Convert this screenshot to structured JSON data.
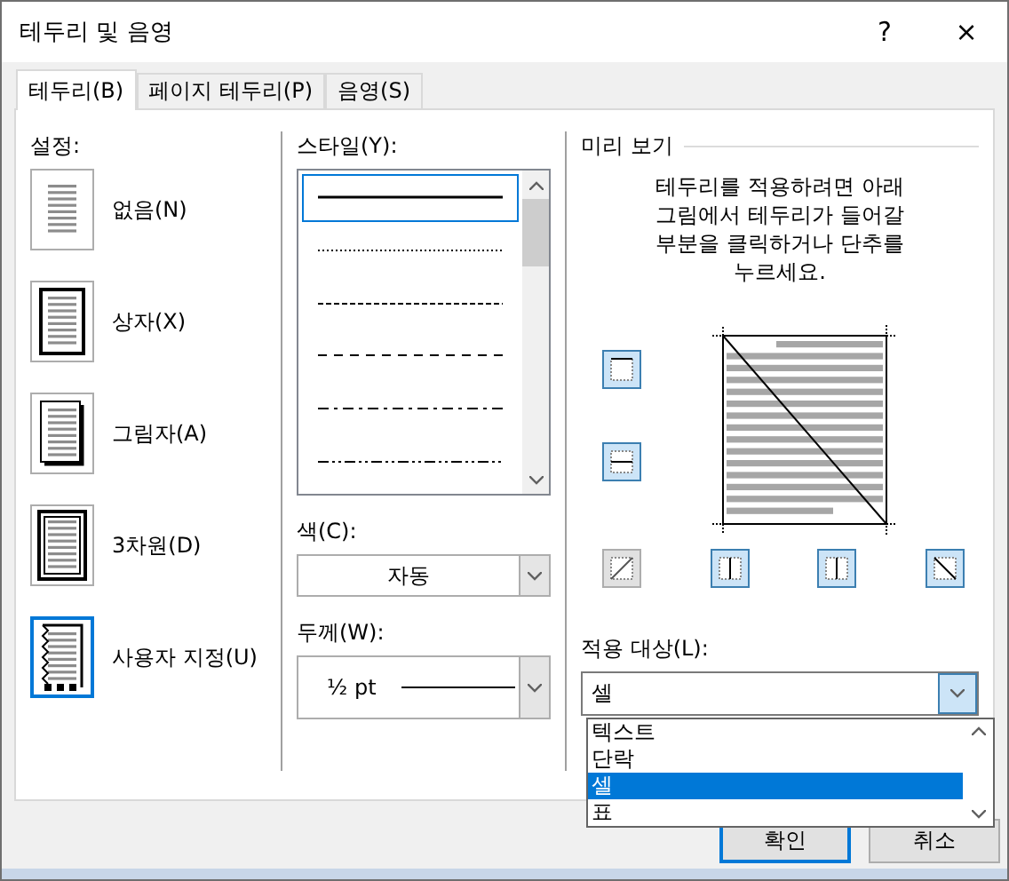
{
  "window": {
    "title": "테두리 및 음영",
    "help": "?",
    "close": "×"
  },
  "tabs": [
    {
      "label": "테두리(B)",
      "selected": true
    },
    {
      "label": "페이지 테두리(P)",
      "selected": false
    },
    {
      "label": "음영(S)",
      "selected": false
    }
  ],
  "settings": {
    "heading": "설정:",
    "items": [
      {
        "label": "없음(N)",
        "kind": "none",
        "selected": false
      },
      {
        "label": "상자(X)",
        "kind": "box",
        "selected": false
      },
      {
        "label": "그림자(A)",
        "kind": "shadow",
        "selected": false
      },
      {
        "label": "3차원(D)",
        "kind": "raised",
        "selected": false
      },
      {
        "label": "사용자 지정(U)",
        "kind": "custom",
        "selected": true
      }
    ]
  },
  "style": {
    "label": "스타일(Y):",
    "lines": [
      {
        "kind": "solid",
        "selected": true
      },
      {
        "kind": "dotted",
        "selected": false
      },
      {
        "kind": "dashed",
        "selected": false
      },
      {
        "kind": "long-dash",
        "selected": false
      },
      {
        "kind": "dash-dot",
        "selected": false
      },
      {
        "kind": "dash-dot-dot",
        "selected": false
      }
    ]
  },
  "color": {
    "label": "색(C):",
    "value": "자동"
  },
  "width": {
    "label": "두께(W):",
    "value": "½ pt"
  },
  "preview": {
    "heading": "미리 보기",
    "instructions": [
      "테두리를 적용하려면 아래",
      "그림에서 테두리가 들어갈",
      "부분을 클릭하거나 단추를",
      "누르세요."
    ],
    "side_buttons": [
      {
        "kind": "top",
        "selected": true
      },
      {
        "kind": "inside-h",
        "selected": true
      }
    ],
    "bottom_buttons": [
      {
        "kind": "diag-up",
        "selected": false
      },
      {
        "kind": "inside-v",
        "selected": true
      },
      {
        "kind": "inside-v",
        "selected": true
      },
      {
        "kind": "diag-down",
        "selected": true
      }
    ]
  },
  "apply_to": {
    "label": "적용 대상(L):",
    "value": "셀",
    "options": [
      {
        "label": "텍스트",
        "selected": false
      },
      {
        "label": "단락",
        "selected": false
      },
      {
        "label": "셀",
        "selected": true
      },
      {
        "label": "표",
        "selected": false
      }
    ]
  },
  "buttons": [
    "확인",
    "취소"
  ]
}
